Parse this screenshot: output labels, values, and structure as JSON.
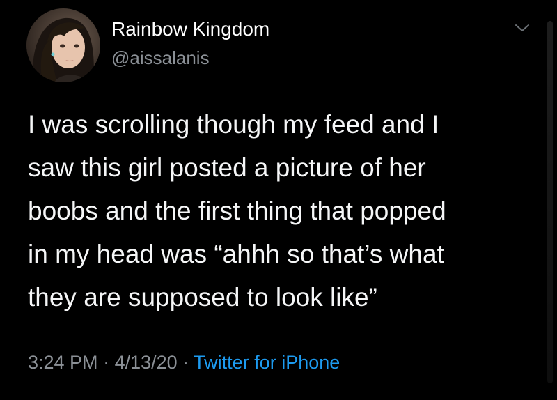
{
  "user": {
    "name": "Rainbow Kingdom",
    "handle": "@aissalanis",
    "avatar": "avatar-photo"
  },
  "tweet": {
    "lines": [
      "I was scrolling though my feed and I",
      "saw this girl posted a picture of her",
      "boobs and the first thing that popped",
      "in my head was “ahhh so that’s what",
      "they are supposed to look like”"
    ]
  },
  "meta": {
    "time": "3:24 PM",
    "separator1": " · ",
    "date": "4/13/20",
    "separator2": " · ",
    "source": "Twitter for iPhone"
  },
  "icons": {
    "menu": "chevron-down-icon"
  },
  "colors": {
    "background": "#000000",
    "text": "#f5f6f7",
    "secondary": "#8b9096",
    "link": "#1d9bf0"
  }
}
